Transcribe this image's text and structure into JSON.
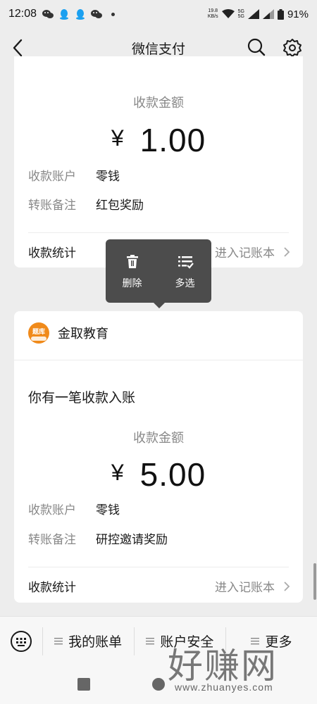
{
  "status_bar": {
    "time": "12:08",
    "speed_top": "19.8",
    "speed_unit": "KB/s",
    "network_1": "5G",
    "network_2": "5G",
    "battery": "91%",
    "icons": [
      "wechat-icon",
      "qq-icon",
      "qq-icon",
      "wechat-icon",
      "dot-icon",
      "wifi-icon",
      "signal-icon",
      "battery-icon"
    ]
  },
  "navbar": {
    "title": "微信支付",
    "icons": [
      "back-icon",
      "search-icon",
      "gear-icon"
    ]
  },
  "card1": {
    "amount_label": "收款金额",
    "currency": "¥",
    "amount": "1.00",
    "rows": [
      {
        "key": "收款账户",
        "value": "零钱"
      },
      {
        "key": "转账备注",
        "value": "红包奖励"
      }
    ],
    "stat_key": "收款统计",
    "stat_value": "进入记账本"
  },
  "context_menu": {
    "items": [
      {
        "label": "删除",
        "icon": "trash-icon"
      },
      {
        "label": "多选",
        "icon": "multiselect-icon"
      }
    ]
  },
  "card2": {
    "merchant_name": "金取教育",
    "logo_text": "题库",
    "notice": "你有一笔收款入账",
    "amount_label": "收款金额",
    "currency": "¥",
    "amount": "5.00",
    "rows": [
      {
        "key": "收款账户",
        "value": "零钱"
      },
      {
        "key": "转账备注",
        "value": "研控邀请奖励"
      }
    ],
    "stat_key": "收款统计",
    "stat_value": "进入记账本"
  },
  "bottom_bar": {
    "items": [
      "我的账单",
      "账户安全",
      "更多"
    ]
  },
  "watermark": {
    "big": "好赚网",
    "small": "www.zhuanyes.com"
  },
  "colors": {
    "background": "#ededed",
    "card": "#ffffff",
    "muted_text": "#888888",
    "popup": "#4c4c4c",
    "logo_orange": "#f08a1a"
  }
}
